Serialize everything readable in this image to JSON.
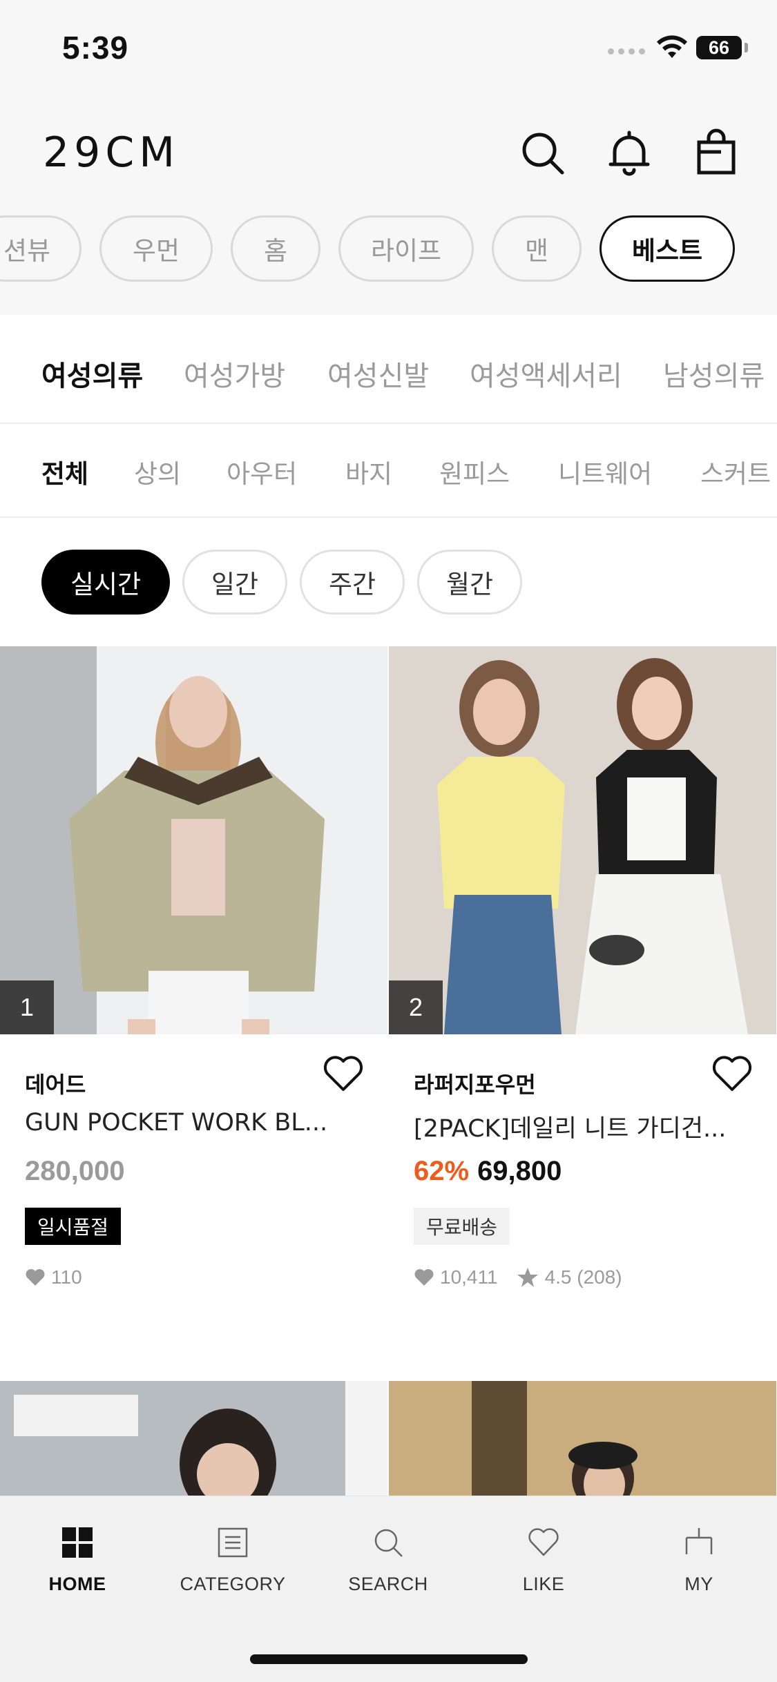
{
  "status": {
    "time": "5:39",
    "battery": "66"
  },
  "header": {
    "logo": "29CM"
  },
  "chips": [
    "션뷰",
    "우먼",
    "홈",
    "라이프",
    "맨",
    "베스트"
  ],
  "category_tabs": [
    "여성의류",
    "여성가방",
    "여성신발",
    "여성액세서리",
    "남성의류"
  ],
  "sub_tabs": [
    "전체",
    "상의",
    "아우터",
    "바지",
    "원피스",
    "니트웨어",
    "스커트"
  ],
  "period_tabs": [
    "실시간",
    "일간",
    "주간",
    "월간"
  ],
  "products": [
    {
      "rank": "1",
      "brand": "데어드",
      "name": "GUN POCKET WORK BL...",
      "price": "280,000",
      "tag": "일시품절",
      "likes": "110"
    },
    {
      "rank": "2",
      "brand": "라퍼지포우먼",
      "name": "[2PACK]데일리 니트 가디건...",
      "discount": "62%",
      "price": "69,800",
      "tag": "무료배송",
      "likes": "10,411",
      "rating": "4.5 (208)"
    }
  ],
  "bottom_nav": [
    "HOME",
    "CATEGORY",
    "SEARCH",
    "LIKE",
    "MY"
  ],
  "colors": {
    "accent_discount": "#ef5b1c",
    "active": "#000000",
    "inactive": "#9a9a9a"
  }
}
